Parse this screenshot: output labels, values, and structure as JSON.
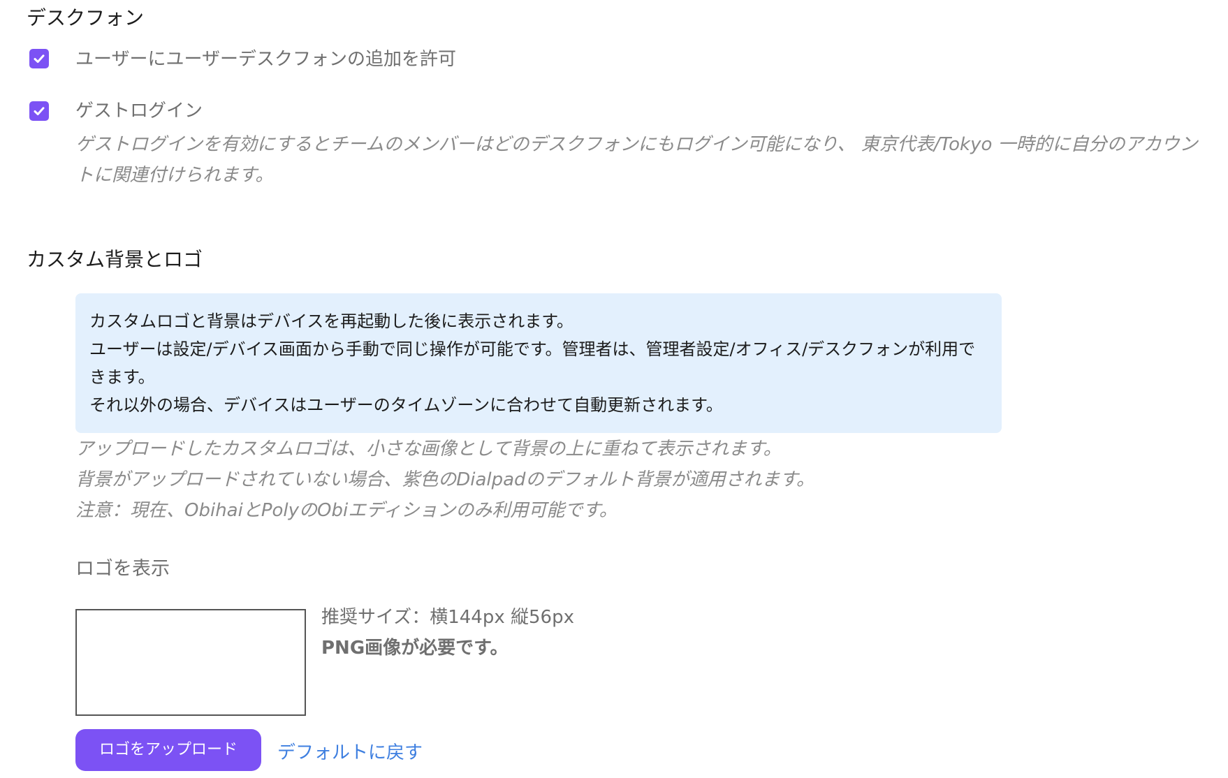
{
  "colors": {
    "accent": "#7c52f4",
    "info_background": "#e3f0fd",
    "link": "#3e7fe0",
    "button_text": "#ffffff"
  },
  "desk_phone": {
    "title": "デスクフォン",
    "allow_user_desk_phone": {
      "checked": true,
      "label": "ユーザーにユーザーデスクフォンの追加を許可"
    },
    "guest_login": {
      "checked": true,
      "label": "ゲストログイン",
      "description": "ゲストログインを有効にするとチームのメンバーはどのデスクフォンにもログイン可能になり、 東京代表/Tokyo 一時的に自分のアカウントに関連付けられます。"
    }
  },
  "custom_branding": {
    "title": "カスタム背景とロゴ",
    "info_lines": [
      "カスタムロゴと背景はデバイスを再起動した後に表示されます。",
      "ユーザーは設定/デバイス画面から手動で同じ操作が可能です。管理者は、管理者設定/オフィス/デスクフォンが利用できます。",
      "それ以外の場合、デバイスはユーザーのタイムゾーンに合わせて自動更新されます。"
    ],
    "notes": [
      "アップロードしたカスタムロゴは、小さな画像として背景の上に重ねて表示されます。",
      "背景がアップロードされていない場合、紫色のDialpadのデフォルト背景が適用されます。",
      "注意：現在、ObihaiとPolyのObiエディションのみ利用可能です。"
    ],
    "logo": {
      "caption": "ロゴを表示",
      "size_hint": "推奨サイズ：横144px 縦56px",
      "format_hint": "PNG画像が必要です。",
      "upload_label": "ロゴをアップロード",
      "reset_label": "デフォルトに戻す"
    }
  }
}
